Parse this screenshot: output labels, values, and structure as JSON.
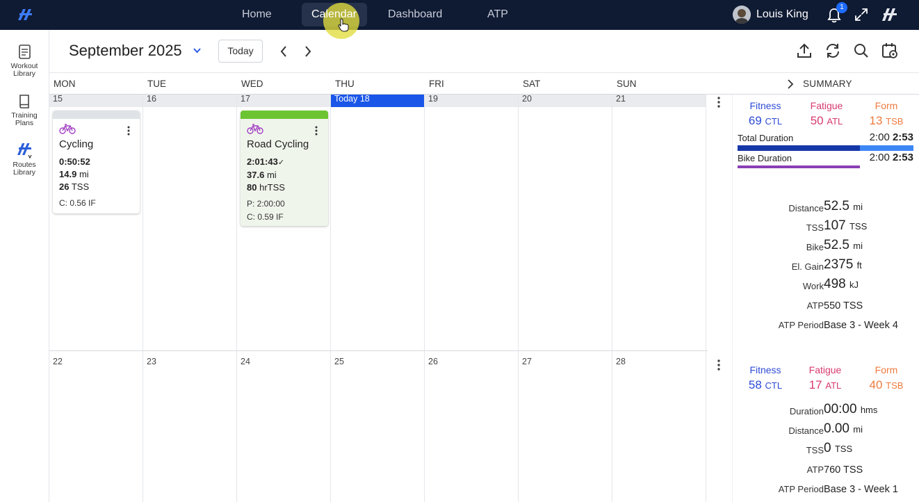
{
  "nav": {
    "items": [
      "Home",
      "Calendar",
      "Dashboard",
      "ATP"
    ],
    "user_name": "Louis King",
    "notification_count": "1"
  },
  "sidebar": {
    "items": [
      {
        "line1": "Workout",
        "line2": "Library"
      },
      {
        "line1": "Training",
        "line2": "Plans"
      },
      {
        "line1": "Routes",
        "line2": "Library"
      }
    ]
  },
  "toolbar": {
    "month": "September 2025",
    "today_label": "Today"
  },
  "calendar": {
    "weekdays": [
      "MON",
      "TUE",
      "WED",
      "THU",
      "FRI",
      "SAT",
      "SUN"
    ],
    "summary_title": "SUMMARY",
    "week1_days": [
      "15",
      "16",
      "17",
      "Today 18",
      "19",
      "20",
      "21"
    ],
    "week2_days": [
      "22",
      "23",
      "24",
      "25",
      "26",
      "27",
      "28"
    ]
  },
  "workouts": [
    {
      "title": "Cycling",
      "duration": "0:50:52",
      "distance": "14.9",
      "distance_unit": "mi",
      "tss": "26",
      "tss_unit": "TSS",
      "foot": [
        "C: 0.56 IF"
      ],
      "top_color": "#dfe3e8"
    },
    {
      "title": "Road Cycling",
      "duration": "2:01:43",
      "check": "✓",
      "distance": "37.6",
      "distance_unit": "mi",
      "tss": "80",
      "tss_unit": "hrTSS",
      "foot": [
        "P: 2:00:00",
        "C: 0.59 IF"
      ],
      "top_color": "#6cc432"
    }
  ],
  "summary": {
    "ffr_labels": [
      "Fitness",
      "Fatigue",
      "Form"
    ],
    "ffr_units": [
      "CTL",
      "ATL",
      "TSB"
    ],
    "week1": {
      "ffr_values": [
        "69",
        "50",
        "13"
      ],
      "durations": [
        {
          "label": "Total Duration",
          "planned": "2:00",
          "completed": "2:53"
        },
        {
          "label": "Bike Duration",
          "planned": "2:00",
          "completed": "2:53"
        }
      ],
      "stats": [
        {
          "key": "Distance",
          "value": "52.5",
          "unit": "mi"
        },
        {
          "key": "TSS",
          "value": "107",
          "unit": "TSS"
        },
        {
          "key": "Bike",
          "value": "52.5",
          "unit": "mi"
        },
        {
          "key": "El. Gain",
          "value": "2375",
          "unit": "ft"
        },
        {
          "key": "Work",
          "value": "498",
          "unit": "kJ"
        },
        {
          "key": "ATP",
          "value": "550 TSS",
          "unit": ""
        },
        {
          "key": "ATP Period",
          "value": "Base 3 - Week 4",
          "unit": ""
        }
      ]
    },
    "week2": {
      "ffr_values": [
        "58",
        "17",
        "40"
      ],
      "stats": [
        {
          "key": "Duration",
          "value": "00:00",
          "unit": "hms"
        },
        {
          "key": "Distance",
          "value": "0.00",
          "unit": "mi"
        },
        {
          "key": "TSS",
          "value": "0",
          "unit": "TSS"
        },
        {
          "key": "ATP",
          "value": "760 TSS",
          "unit": ""
        },
        {
          "key": "ATP Period",
          "value": "Base 3 - Week 1",
          "unit": ""
        }
      ]
    }
  },
  "colors": {
    "topbar": "#0f1a33",
    "today": "#1a56e8",
    "fitness": "#2d4bd6",
    "fatigue": "#d83a6e",
    "form": "#ee7a3e",
    "total_bar_dark": "#1537a8",
    "total_bar_light": "#3d86f5",
    "bike_bar": "#8a3fb5",
    "bike_icon": "#a23ec2"
  }
}
